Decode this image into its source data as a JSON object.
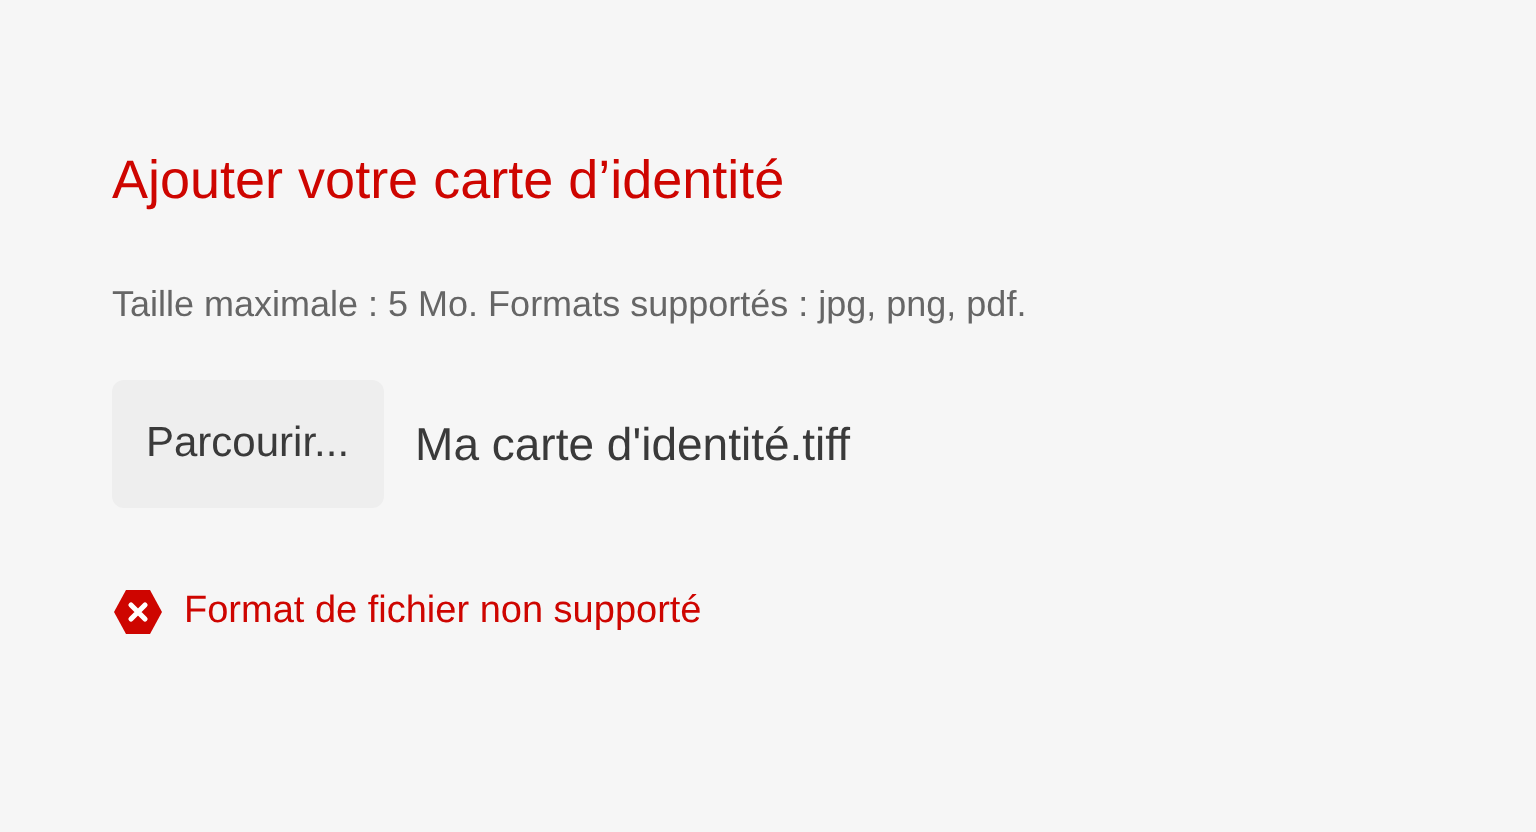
{
  "upload": {
    "label": "Ajouter votre carte d’identité",
    "hint": "Taille maximale : 5 Mo. Formats supportés : jpg, png, pdf.",
    "button": "Parcourir...",
    "file_name": "Ma carte d'identité.tiff",
    "error": true,
    "message": "Format de fichier non supporté"
  }
}
